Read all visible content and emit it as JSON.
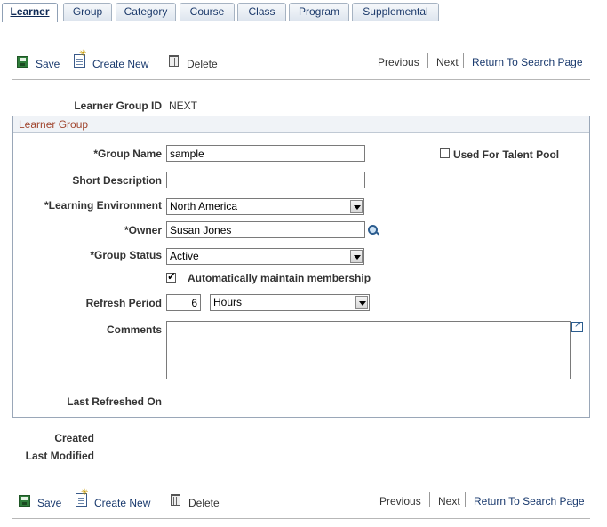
{
  "tabs": [
    {
      "label": "Learner",
      "active": true
    },
    {
      "label": "Group",
      "active": false
    },
    {
      "label": "Category",
      "active": false
    },
    {
      "label": "Course",
      "active": false
    },
    {
      "label": "Class",
      "active": false
    },
    {
      "label": "Program",
      "active": false
    },
    {
      "label": "Supplemental",
      "active": false
    }
  ],
  "toolbar": {
    "save": "Save",
    "create_new": "Create New",
    "delete": "Delete",
    "previous": "Previous",
    "next": "Next",
    "return": "Return To Search Page"
  },
  "learner_group_id": {
    "label": "Learner Group ID",
    "value": "NEXT"
  },
  "group_box_title": "Learner Group",
  "form": {
    "group_name": {
      "label": "*Group Name",
      "value": "sample"
    },
    "used_for_talent_pool": {
      "label": "Used For Talent Pool",
      "checked": false
    },
    "short_description": {
      "label": "Short Description",
      "value": ""
    },
    "learning_environment": {
      "label": "*Learning Environment",
      "value": "North America"
    },
    "owner": {
      "label": "*Owner",
      "value": "Susan Jones"
    },
    "group_status": {
      "label": "*Group Status",
      "value": "Active"
    },
    "auto_maintain": {
      "label": "Automatically maintain membership",
      "checked": true
    },
    "refresh_period": {
      "label": "Refresh Period",
      "value": "6",
      "unit": "Hours"
    },
    "comments": {
      "label": "Comments",
      "value": ""
    },
    "last_refreshed_on": {
      "label": "Last Refreshed On",
      "value": ""
    }
  },
  "audit": {
    "created": "Created",
    "last_modified": "Last Modified"
  }
}
